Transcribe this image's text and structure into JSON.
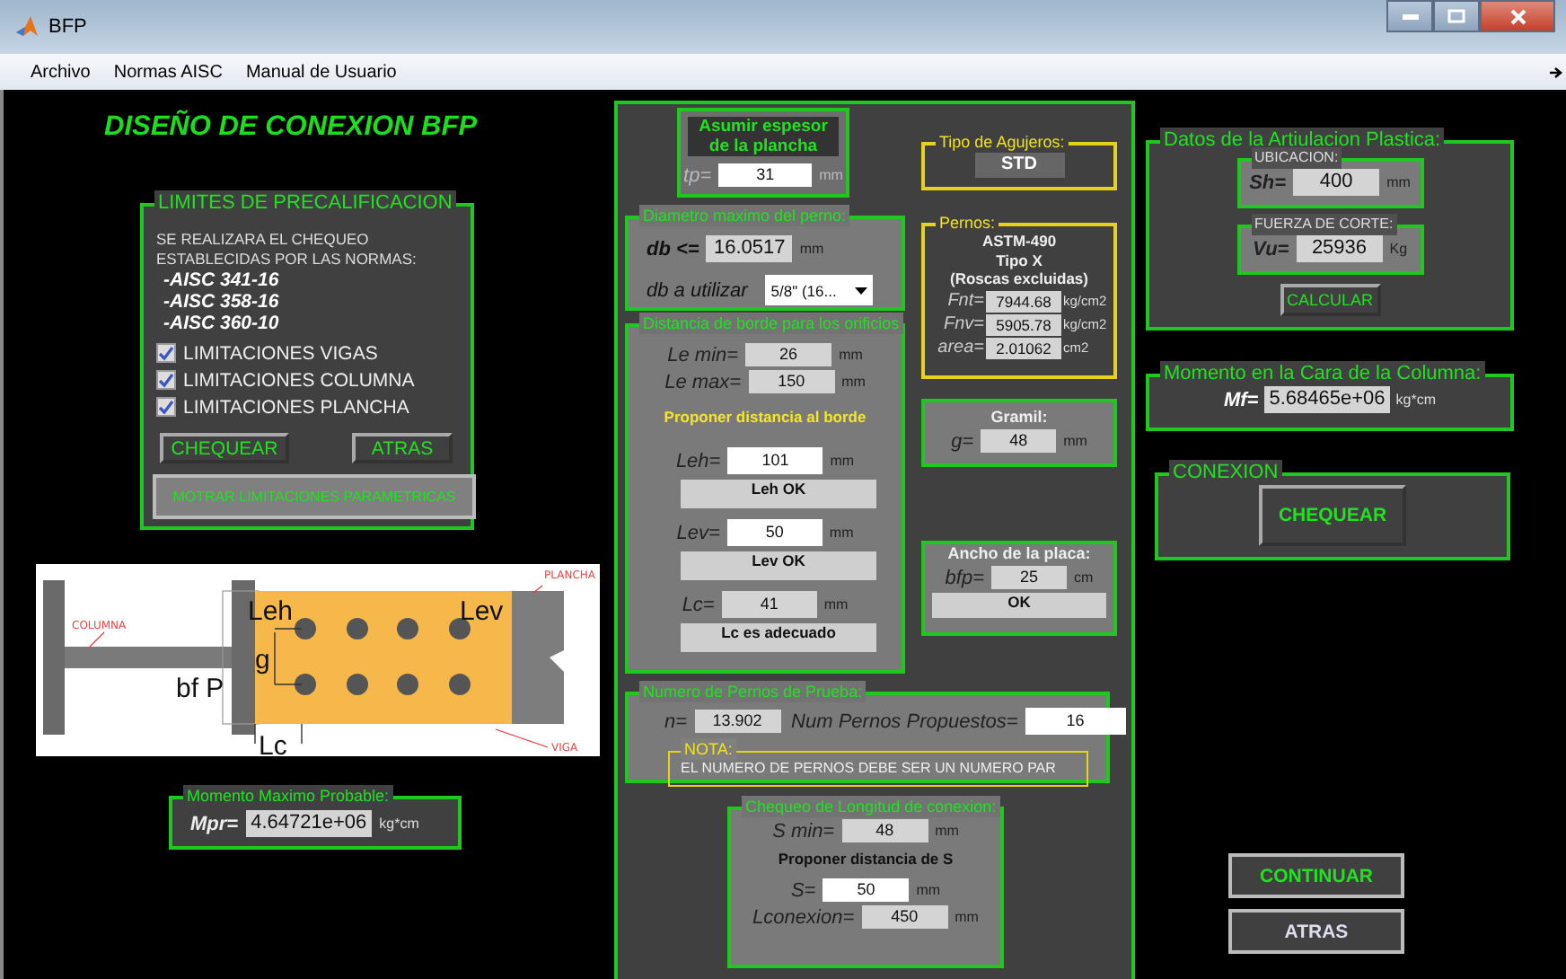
{
  "window": {
    "title": "BFP"
  },
  "menu": [
    {
      "label": "Archivo"
    },
    {
      "label": "Normas AISC"
    },
    {
      "label": "Manual de Usuario"
    }
  ],
  "heading": "DISEÑO DE CONEXION BFP",
  "prequalification": {
    "title": "LIMITES DE PRECALIFICACION",
    "intro": "SE REALIZARA EL CHEQUEO ESTABLECIDAS POR LAS NORMAS:",
    "norms": [
      "-AISC 341-16",
      "-AISC 358-16",
      "-AISC 360-10"
    ],
    "checks": [
      {
        "label": "LIMITACIONES VIGAS",
        "checked": true
      },
      {
        "label": "LIMITACIONES COLUMNA",
        "checked": true
      },
      {
        "label": "LIMITACIONES PLANCHA",
        "checked": true
      }
    ],
    "buttons": [
      "CHEQUEAR",
      "ATRAS"
    ],
    "wide_button": "MOTRAR LIMITACIONES PARAMETRICAS"
  },
  "diagram": {
    "column": "COLUMNA",
    "plate": "PLANCHA",
    "beam": "VIGA",
    "leh": "Leh",
    "lev": "Lev",
    "bf": "bf P",
    "g": "g",
    "lc": "Lc"
  },
  "mpr": {
    "title": "Momento Maximo Probable:",
    "field": {
      "label": "Mpr=",
      "value": "4.64721e+06",
      "unit": "kg*cm",
      "editable": false
    }
  },
  "plate_thickness": {
    "title": "Asumir espesor de la plancha",
    "field": {
      "label": "tp=",
      "value": "31",
      "unit": "mm",
      "editable": true
    }
  },
  "bolt_diameter": {
    "title": "Diametro maximo del perno:",
    "max": {
      "label": "db <=",
      "value": "16.0517",
      "unit": "mm",
      "editable": false
    },
    "select": {
      "label": "db a utilizar",
      "value": "5/8\" (16..."
    }
  },
  "edge_distance": {
    "title": "Distancia de borde para los orificios",
    "fields": [
      {
        "label": "Le min=",
        "value": "26",
        "unit": "mm",
        "editable": false
      },
      {
        "label": "Le max=",
        "value": "150",
        "unit": "mm",
        "editable": false
      }
    ],
    "prompt": "Proponer distancia al borde",
    "checks": [
      {
        "field": {
          "label": "Leh=",
          "value": "101",
          "unit": "mm",
          "editable": true
        },
        "message": "Leh OK"
      },
      {
        "field": {
          "label": "Lev=",
          "value": "50",
          "unit": "mm",
          "editable": true
        },
        "message": "Lev OK"
      },
      {
        "field": {
          "label": "Lc=",
          "value": "41",
          "unit": "mm",
          "editable": false
        },
        "message": "Lc es adecuado"
      }
    ]
  },
  "hole_type": {
    "title": "Tipo de Agujeros:",
    "value": "STD"
  },
  "bolts": {
    "title": "Pernos:",
    "spec": [
      "ASTM-490",
      "Tipo X",
      "(Roscas excluidas)"
    ],
    "fields": [
      {
        "label": "Fnt=",
        "value": "7944.68",
        "unit": "kg/cm2",
        "editable": false
      },
      {
        "label": "Fnv=",
        "value": "5905.78",
        "unit": "kg/cm2",
        "editable": false
      },
      {
        "label": "area=",
        "value": "2.01062",
        "unit": "cm2",
        "editable": false
      }
    ]
  },
  "gage": {
    "title": "Gramil:",
    "field": {
      "label": "g=",
      "value": "48",
      "unit": "mm",
      "editable": false
    }
  },
  "plate_width": {
    "title": "Ancho de la placa:",
    "field": {
      "label": "bfp=",
      "value": "25",
      "unit": "cm",
      "editable": false
    },
    "message": "OK"
  },
  "bolt_count": {
    "title": "Numero de Pernos de Prueba:",
    "n": {
      "label": "n=",
      "value": "13.902",
      "editable": false
    },
    "proposed": {
      "label": "Num Pernos Propuestos=",
      "value": "16",
      "editable": true
    },
    "note": {
      "title": "NOTA:",
      "text": "EL NUMERO DE PERNOS DEBE SER UN NUMERO PAR"
    }
  },
  "length_check": {
    "title": "Chequeo de Longitud de conexion:",
    "min": {
      "label": "S min=",
      "value": "48",
      "unit": "mm",
      "editable": false
    },
    "prompt": "Proponer distancia de S",
    "fields": [
      {
        "label": "S=",
        "value": "50",
        "unit": "mm",
        "editable": true
      },
      {
        "label": "Lconexion=",
        "value": "450",
        "unit": "mm",
        "editable": false
      }
    ]
  },
  "hinge": {
    "title": "Datos de la Artiulacion Plastica:",
    "groups": [
      {
        "title": "UBICACION:",
        "field": {
          "label": "Sh=",
          "value": "400",
          "unit": "mm",
          "editable": false
        }
      },
      {
        "title": "FUERZA DE CORTE:",
        "field": {
          "label": "Vu=",
          "value": "25936",
          "unit": "Kg",
          "editable": false
        }
      }
    ],
    "button": "CALCULAR"
  },
  "column_face": {
    "title": "Momento en la Cara de la Columna:",
    "field": {
      "label": "Mf=",
      "value": "5.68465e+06",
      "unit": "kg*cm",
      "editable": false
    }
  },
  "connection": {
    "title": "CONEXION",
    "button": "CHEQUEAR"
  },
  "actions": [
    {
      "label": "CONTINUAR",
      "kind": "primary"
    },
    {
      "label": "ATRAS",
      "kind": "secondary"
    }
  ]
}
